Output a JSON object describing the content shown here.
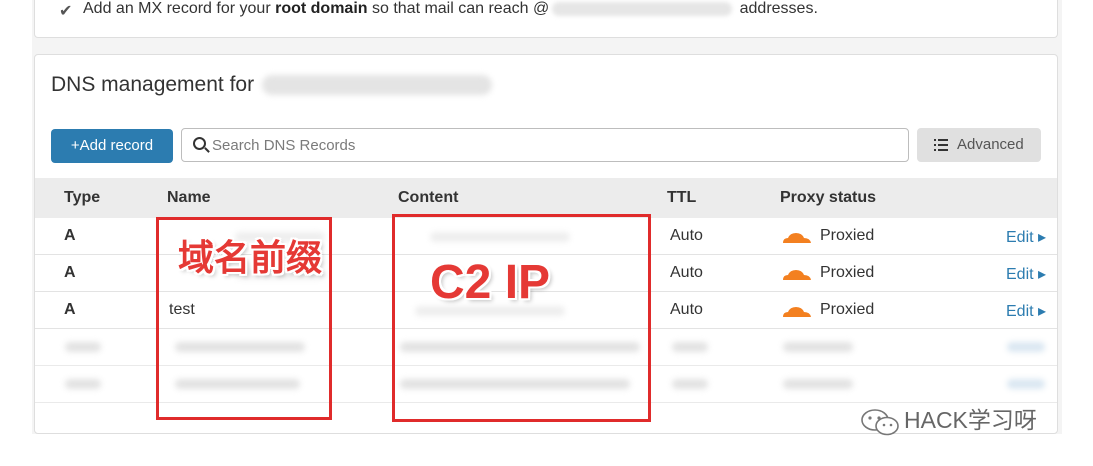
{
  "banner": {
    "text_before": "Add an MX record for your ",
    "bold": "root domain",
    "text_after": " so that mail can reach @",
    "text_end": " addresses."
  },
  "dns": {
    "title": "DNS management for",
    "add_button": "+Add record",
    "search_placeholder": "Search DNS Records",
    "advanced_button": "Advanced"
  },
  "table": {
    "headers": [
      "Type",
      "Name",
      "Content",
      "TTL",
      "Proxy status"
    ],
    "rows": [
      {
        "type": "A",
        "name": "",
        "ttl": "Auto",
        "proxy": "Proxied",
        "edit": "Edit"
      },
      {
        "type": "A",
        "name": "",
        "ttl": "Auto",
        "proxy": "Proxied",
        "edit": "Edit"
      },
      {
        "type": "A",
        "name": "test",
        "ttl": "Auto",
        "proxy": "Proxied",
        "edit": "Edit"
      }
    ]
  },
  "annotations": {
    "name_label": "域名前缀",
    "content_label": "C2 IP"
  },
  "watermark": "HACK学习呀",
  "colors": {
    "primary": "#2c7cb0",
    "annotation_red": "#e02b2b",
    "cloud_orange": "#f38020"
  }
}
